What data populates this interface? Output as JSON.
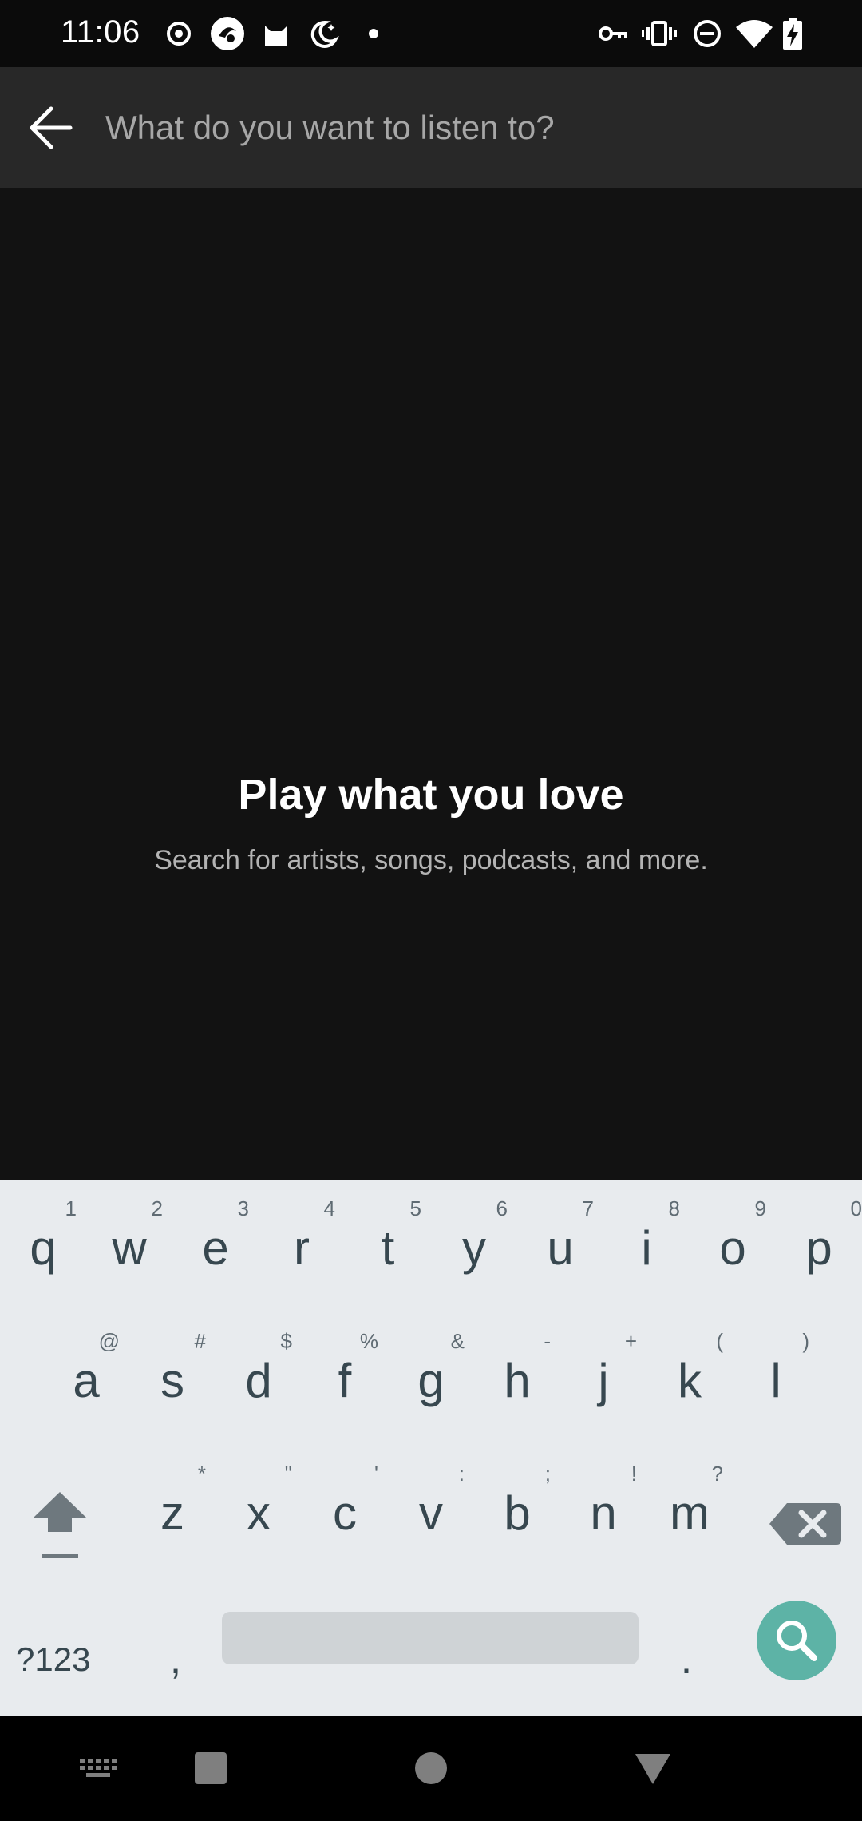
{
  "status_bar": {
    "time": "11:06",
    "left_icons": [
      "record-icon",
      "app-icon",
      "cat-icon",
      "night-mode-icon",
      "notification-dot-icon"
    ],
    "right_icons": [
      "vpn-key-icon",
      "vibrate-icon",
      "do-not-disturb-icon",
      "wifi-icon",
      "battery-charging-icon"
    ]
  },
  "search": {
    "placeholder": "What do you want to listen to?",
    "value": ""
  },
  "empty_state": {
    "title": "Play what you love",
    "subtitle": "Search for artists, songs, podcasts, and more."
  },
  "keyboard": {
    "row1": [
      {
        "key": "q",
        "alt": "1"
      },
      {
        "key": "w",
        "alt": "2"
      },
      {
        "key": "e",
        "alt": "3"
      },
      {
        "key": "r",
        "alt": "4"
      },
      {
        "key": "t",
        "alt": "5"
      },
      {
        "key": "y",
        "alt": "6"
      },
      {
        "key": "u",
        "alt": "7"
      },
      {
        "key": "i",
        "alt": "8"
      },
      {
        "key": "o",
        "alt": "9"
      },
      {
        "key": "p",
        "alt": "0"
      }
    ],
    "row2": [
      {
        "key": "a",
        "alt": "@"
      },
      {
        "key": "s",
        "alt": "#"
      },
      {
        "key": "d",
        "alt": "$"
      },
      {
        "key": "f",
        "alt": "%"
      },
      {
        "key": "g",
        "alt": "&"
      },
      {
        "key": "h",
        "alt": "-"
      },
      {
        "key": "j",
        "alt": "+"
      },
      {
        "key": "k",
        "alt": "("
      },
      {
        "key": "l",
        "alt": ")"
      }
    ],
    "row3": [
      {
        "key": "z",
        "alt": "*"
      },
      {
        "key": "x",
        "alt": "\""
      },
      {
        "key": "c",
        "alt": "'"
      },
      {
        "key": "v",
        "alt": ":"
      },
      {
        "key": "b",
        "alt": ";"
      },
      {
        "key": "n",
        "alt": "!"
      },
      {
        "key": "m",
        "alt": "?"
      }
    ],
    "symbols_label": "?123",
    "comma": ",",
    "period": ".",
    "accent_color": "#5db3a6",
    "background": "#e8ebee"
  },
  "nav_bar": {
    "icons": [
      "keyboard-switch-icon",
      "recents-icon",
      "home-icon",
      "back-icon"
    ]
  }
}
